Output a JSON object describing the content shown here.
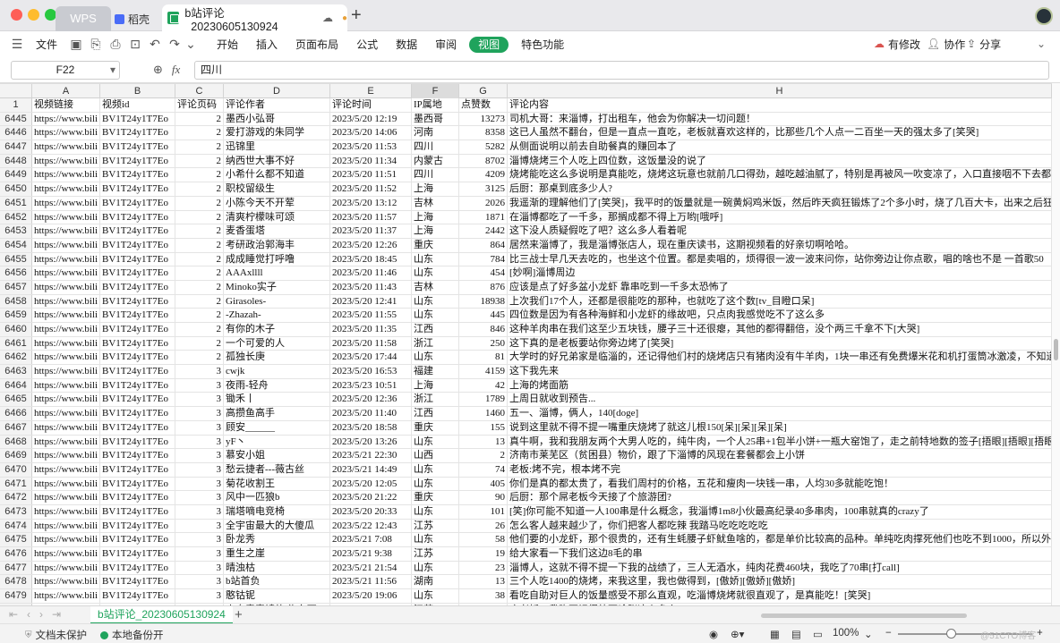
{
  "window": {
    "tabs": {
      "wps": "WPS",
      "daoke": "稻壳",
      "doc": "b站评论_20230605130924"
    }
  },
  "menu": {
    "file": "文件",
    "items": [
      "开始",
      "插入",
      "页面布局",
      "公式",
      "数据",
      "审阅",
      "视图",
      "特色功能"
    ],
    "modified": "有修改",
    "collab": "协作",
    "share": "分享"
  },
  "formula": {
    "cell_ref": "F22",
    "fx": "fx",
    "value": "四川"
  },
  "grid": {
    "columns": [
      "A",
      "B",
      "C",
      "D",
      "E",
      "F",
      "G",
      "H"
    ],
    "selected_column": "F",
    "header_row": {
      "num": "1",
      "cells": [
        "视频链接",
        "视频id",
        "评论页码",
        "评论作者",
        "评论时间",
        "IP属地",
        "点赞数",
        "评论内容"
      ]
    },
    "rows": [
      {
        "n": "6445",
        "a": "https://www.bili",
        "b": "BV1T24y1T7Eo",
        "c": "2",
        "d": "墨西小弘哥",
        "e": "2023/5/20 12:19",
        "f": "墨西哥",
        "g": "13273",
        "h": "司机大哥：来淄博，打出租车，他会为你解决一切问题！"
      },
      {
        "n": "6446",
        "a": "https://www.bili",
        "b": "BV1T24y1T7Eo",
        "c": "2",
        "d": "爱打游戏的朱同学",
        "e": "2023/5/20 14:06",
        "f": "河南",
        "g": "8358",
        "h": "这已人虽然不翻台，但是一直点一直吃，老板就喜欢这样的，比那些几个人点一二百坐一天的强太多了[笑哭]"
      },
      {
        "n": "6447",
        "a": "https://www.bili",
        "b": "BV1T24y1T7Eo",
        "c": "2",
        "d": "迅锦里",
        "e": "2023/5/20 11:53",
        "f": "四川",
        "g": "5282",
        "h": "从侧面说明以前去自助餐真的赚回本了"
      },
      {
        "n": "6448",
        "a": "https://www.bili",
        "b": "BV1T24y1T7Eo",
        "c": "2",
        "d": "纳西世大事不好",
        "e": "2023/5/20 11:34",
        "f": "内蒙古",
        "g": "8702",
        "h": "淄博烧烤三个人吃上四位数，这饭量没的说了"
      },
      {
        "n": "6449",
        "a": "https://www.bili",
        "b": "BV1T24y1T7Eo",
        "c": "2",
        "d": "小希什么都不知道",
        "e": "2023/5/20 11:51",
        "f": "四川",
        "g": "4209",
        "h": "烧烤能吃这么多说明是真能吃，烧烤这玩意也就前几口得劲，越吃越油腻了，特别是再被风一吹变凉了，入口直接咽不下去都"
      },
      {
        "n": "6450",
        "a": "https://www.bili",
        "b": "BV1T24y1T7Eo",
        "c": "2",
        "d": "职校留级生",
        "e": "2023/5/20 11:52",
        "f": "上海",
        "g": "3125",
        "h": "后厨：那桌到底多少人?"
      },
      {
        "n": "6451",
        "a": "https://www.bili",
        "b": "BV1T24y1T7Eo",
        "c": "2",
        "d": "小陈今天不开荤",
        "e": "2023/5/20 13:12",
        "f": "吉林",
        "g": "2026",
        "h": "我遥渐的理解他们了[笑哭]，我平时的饭量就是一碗黄焖鸡米饭，然后昨天疯狂锻炼了2个多小时，烧了几百大卡，出来之后狂开"
      },
      {
        "n": "6452",
        "a": "https://www.bili",
        "b": "BV1T24y1T7Eo",
        "c": "2",
        "d": "清爽柠檬味可颂",
        "e": "2023/5/20 11:57",
        "f": "上海",
        "g": "1871",
        "h": "在淄博都吃了一千多，那搁成都不得上万哟[哦呼]"
      },
      {
        "n": "6453",
        "a": "https://www.bili",
        "b": "BV1T24y1T7Eo",
        "c": "2",
        "d": "麦香蛋塔",
        "e": "2023/5/20 11:37",
        "f": "上海",
        "g": "2442",
        "h": "这下没人质疑假吃了吧？这么多人看着呢"
      },
      {
        "n": "6454",
        "a": "https://www.bili",
        "b": "BV1T24y1T7Eo",
        "c": "2",
        "d": "考研政治郭海丰",
        "e": "2023/5/20 12:26",
        "f": "重庆",
        "g": "864",
        "h": "居然来淄博了，我是淄博张店人，现在重庆读书，这期视频看的好亲切啊哈哈。"
      },
      {
        "n": "6455",
        "a": "https://www.bili",
        "b": "BV1T24y1T7Eo",
        "c": "2",
        "d": "成成睡觉打呼噜",
        "e": "2023/5/20 18:45",
        "f": "山东",
        "g": "784",
        "h": "比三战士早几天去吃的，也坐这个位置。都是卖唱的，烦得很一波一波来问你，站你旁边让你点歌，唱的啥也不是 一首歌50"
      },
      {
        "n": "6456",
        "a": "https://www.bili",
        "b": "BV1T24y1T7Eo",
        "c": "2",
        "d": "AAAxllll",
        "e": "2023/5/20 11:46",
        "f": "山东",
        "g": "454",
        "h": "[妙啊]淄博周边"
      },
      {
        "n": "6457",
        "a": "https://www.bili",
        "b": "BV1T24y1T7Eo",
        "c": "2",
        "d": "Minoko实子",
        "e": "2023/5/20 11:43",
        "f": "吉林",
        "g": "876",
        "h": "应该是点了好多盆小龙虾 靠串吃到一千多太恐怖了"
      },
      {
        "n": "6458",
        "a": "https://www.bili",
        "b": "BV1T24y1T7Eo",
        "c": "2",
        "d": "Girasoles-",
        "e": "2023/5/20 12:41",
        "f": "山东",
        "g": "18938",
        "h": "上次我们17个人，还都是很能吃的那种，也就吃了这个数[tv_目瞪口呆]"
      },
      {
        "n": "6459",
        "a": "https://www.bili",
        "b": "BV1T24y1T7Eo",
        "c": "2",
        "d": "-Zhazah-",
        "e": "2023/5/20 11:55",
        "f": "山东",
        "g": "445",
        "h": "四位数是因为有各种海鲜和小龙虾的缘故吧，只点肉我感觉吃不了这么多"
      },
      {
        "n": "6460",
        "a": "https://www.bili",
        "b": "BV1T24y1T7Eo",
        "c": "2",
        "d": "有你的木子",
        "e": "2023/5/20 11:35",
        "f": "江西",
        "g": "846",
        "h": "这种羊肉串在我们这至少五块钱，腰子三十还很瘪，其他的都得翻倍，没个两三千拿不下[大哭]"
      },
      {
        "n": "6461",
        "a": "https://www.bili",
        "b": "BV1T24y1T7Eo",
        "c": "2",
        "d": "一个可爱的人",
        "e": "2023/5/20 11:58",
        "f": "浙江",
        "g": "250",
        "h": "这下真的是老板要站你旁边烤了[笑哭]"
      },
      {
        "n": "6462",
        "a": "https://www.bili",
        "b": "BV1T24y1T7Eo",
        "c": "2",
        "d": "孤独长庚",
        "e": "2023/5/20 17:44",
        "f": "山东",
        "g": "81",
        "h": "大学时的好兄弟家是临淄的，还记得他们村的烧烤店只有猪肉没有牛羊肉，1块一串还有免费爆米花和机打蛋筒冰激凌，不知道"
      },
      {
        "n": "6463",
        "a": "https://www.bili",
        "b": "BV1T24y1T7Eo",
        "c": "3",
        "d": "cwjk",
        "e": "2023/5/20 16:53",
        "f": "福建",
        "g": "4159",
        "h": "这下我先来"
      },
      {
        "n": "6464",
        "a": "https://www.bili",
        "b": "BV1T24y1T7Eo",
        "c": "3",
        "d": "夜雨-轻舟",
        "e": "2023/5/23 10:51",
        "f": "上海",
        "g": "42",
        "h": "上海的烤面筋"
      },
      {
        "n": "6465",
        "a": "https://www.bili",
        "b": "BV1T24y1T7Eo",
        "c": "3",
        "d": "锄禾丨",
        "e": "2023/5/20 12:36",
        "f": "浙江",
        "g": "1789",
        "h": "上周日就收到预告..."
      },
      {
        "n": "6466",
        "a": "https://www.bili",
        "b": "BV1T24y1T7Eo",
        "c": "3",
        "d": "高攒鱼高手",
        "e": "2023/5/20 11:40",
        "f": "江西",
        "g": "1460",
        "h": "五一、淄博，俩人，140[doge]"
      },
      {
        "n": "6467",
        "a": "https://www.bili",
        "b": "BV1T24y1T7Eo",
        "c": "3",
        "d": "顾安______",
        "e": "2023/5/20 18:58",
        "f": "重庆",
        "g": "155",
        "h": "说到这里就不得不提一嘴重庆烧烤了就这儿根150[呆][呆][呆][呆]"
      },
      {
        "n": "6468",
        "a": "https://www.bili",
        "b": "BV1T24y1T7Eo",
        "c": "3",
        "d": "yF丶",
        "e": "2023/5/20 13:26",
        "f": "山东",
        "g": "13",
        "h": "真牛啊，我和我朋友两个大男人吃的，纯牛肉，一个人25串+1包半小饼+一瓶大窑饱了，走之前特地数的签子[捂眼][捂眼][捂眼]"
      },
      {
        "n": "6469",
        "a": "https://www.bili",
        "b": "BV1T24y1T7Eo",
        "c": "3",
        "d": "慕安小姐",
        "e": "2023/5/21 22:30",
        "f": "山西",
        "g": "2",
        "h": "济南市莱芜区（贫困县）物价，跟了下淄博的风现在套餐都会上小饼"
      },
      {
        "n": "6470",
        "a": "https://www.bili",
        "b": "BV1T24y1T7Eo",
        "c": "3",
        "d": "愁云捷者---薇古丝",
        "e": "2023/5/21 14:49",
        "f": "山东",
        "g": "74",
        "h": "老板:烤不完，根本烤不完"
      },
      {
        "n": "6471",
        "a": "https://www.bili",
        "b": "BV1T24y1T7Eo",
        "c": "3",
        "d": "菊花收割王",
        "e": "2023/5/20 12:05",
        "f": "山东",
        "g": "405",
        "h": "你们是真的都太贵了，看我们周村的价格，五花和瘦肉一块钱一串，人均30多就能吃饱！"
      },
      {
        "n": "6472",
        "a": "https://www.bili",
        "b": "BV1T24y1T7Eo",
        "c": "3",
        "d": "风中一匹狼b",
        "e": "2023/5/20 21:22",
        "f": "重庆",
        "g": "90",
        "h": "后厨：那个屌老板今天接了个旅游团?"
      },
      {
        "n": "6473",
        "a": "https://www.bili",
        "b": "BV1T24y1T7Eo",
        "c": "3",
        "d": "瑞塔嘀电竞椅",
        "e": "2023/5/20 20:33",
        "f": "山东",
        "g": "101",
        "h": "[笑]你可能不知道一人100串是什么概念，我淄博1m8小伙最高纪录40多串肉，100串就真的crazy了"
      },
      {
        "n": "6474",
        "a": "https://www.bili",
        "b": "BV1T24y1T7Eo",
        "c": "3",
        "d": "全宇宙最大的大傻瓜",
        "e": "2023/5/22 12:43",
        "f": "江苏",
        "g": "26",
        "h": "怎么客人越来越少了，你们把客人都吃辣  我踏马吃吃吃吃吃"
      },
      {
        "n": "6475",
        "a": "https://www.bili",
        "b": "BV1T24y1T7Eo",
        "c": "3",
        "d": "卧龙秀",
        "e": "2023/5/21 7:08",
        "f": "山东",
        "g": "58",
        "h": "他们要的小龙虾，那个很贵的，还有生蚝腰子虾鱿鱼啥的，都是单价比较高的品种。单纯吃肉撑死他们也吃不到1000，所以外地"
      },
      {
        "n": "6476",
        "a": "https://www.bili",
        "b": "BV1T24y1T7Eo",
        "c": "3",
        "d": "重生之崖",
        "e": "2023/5/21 9:38",
        "f": "江苏",
        "g": "19",
        "h": "给大家看一下我们这边8毛的串"
      },
      {
        "n": "6477",
        "a": "https://www.bili",
        "b": "BV1T24y1T7Eo",
        "c": "3",
        "d": "晴浊枯",
        "e": "2023/5/21 21:54",
        "f": "山东",
        "g": "23",
        "h": "淄博人，这就不得不提一下我的战绩了，三人无酒水，纯肉花费460块，我吃了70串[打call]"
      },
      {
        "n": "6478",
        "a": "https://www.bili",
        "b": "BV1T24y1T7Eo",
        "c": "3",
        "d": "b站首负",
        "e": "2023/5/21 11:56",
        "f": "湖南",
        "g": "13",
        "h": "三个人吃1400的烧烤，来我这里，我也做得到，[傲娇][傲娇][傲娇]"
      },
      {
        "n": "6479",
        "a": "https://www.bili",
        "b": "BV1T24y1T7Eo",
        "c": "3",
        "d": "憨钴铌",
        "e": "2023/5/20 19:06",
        "f": "山东",
        "g": "38",
        "h": "看吃自助对巨人的饭量感受不那么直观，吃淄博烧烤就很直观了，是真能吃！[笑哭]"
      },
      {
        "n": "6480",
        "a": "https://www.bili",
        "b": "BV1T24y1T7Eo",
        "c": "3",
        "d": "来自意麦镜的 俺东西",
        "e": "2023/5/21 10:07",
        "f": "江苏",
        "g": "21",
        "h": "店老板：我昨不记得外面啥账这么多人[doge]"
      }
    ]
  },
  "sheetbar": {
    "sheet_name": "b站评论_20230605130924",
    "add": "+"
  },
  "status": {
    "protect": "文档未保护",
    "backup": "本地备份开",
    "zoom": "100%",
    "watermark": "@51CTO博客"
  }
}
